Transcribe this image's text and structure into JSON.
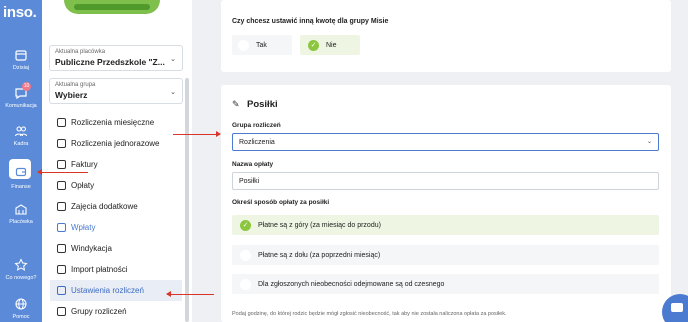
{
  "rail": {
    "logo": "inso.",
    "items": [
      {
        "label": "Dzisiaj",
        "icon": "calendar-icon"
      },
      {
        "label": "Komunikacja",
        "icon": "chat-icon",
        "badge": "10"
      },
      {
        "label": "Kadra",
        "icon": "people-icon"
      },
      {
        "label": "Finanse",
        "icon": "wallet-icon"
      },
      {
        "label": "Placówka",
        "icon": "building-icon"
      },
      {
        "label": "Co nowego?",
        "icon": "star-icon"
      },
      {
        "label": "Pomoc",
        "icon": "globe-icon"
      }
    ]
  },
  "sidebar": {
    "facility_label": "Aktualna placówka",
    "facility_value": "Publiczne Przedszkole \"Z...",
    "group_label": "Aktualna grupa",
    "group_value": "Wybierz",
    "menu": [
      "Rozliczenia miesięczne",
      "Rozliczenia jednorazowe",
      "Faktury",
      "Opłaty",
      "Zajęcia dodatkowe",
      "Wpłaty",
      "Windykacja",
      "Import płatności",
      "Ustawienia rozliczeń",
      "Grupy rozliczeń"
    ]
  },
  "top_card": {
    "question": "Czy chcesz ustawić inną kwotę dla grupy Misie",
    "option_yes": "Tak",
    "option_no": "Nie",
    "selected": "Nie"
  },
  "meals": {
    "title": "Posiłki",
    "group_label": "Grupa rozliczeń",
    "group_value": "Rozliczenia",
    "fee_label": "Nazwa opłaty",
    "fee_value": "Posiłki",
    "method_label": "Określ sposób opłaty za posiłki",
    "options": [
      "Płatne są z góry (za miesiąc do przodu)",
      "Płatne są z dołu (za poprzedni miesiąc)",
      "Dla zgłoszonych nieobecności odejmowane są od czesnego"
    ],
    "selected_option": 0,
    "note": "Podaj godzinę, do której rodzic będzie mógł zgłosić nieobecność, tak aby nie została naliczona opłata za posiłek."
  },
  "colors": {
    "rail": "#5b8bd8",
    "accent": "#4a7bd0",
    "check": "#8cc63f",
    "annotation": "#d9362b"
  }
}
